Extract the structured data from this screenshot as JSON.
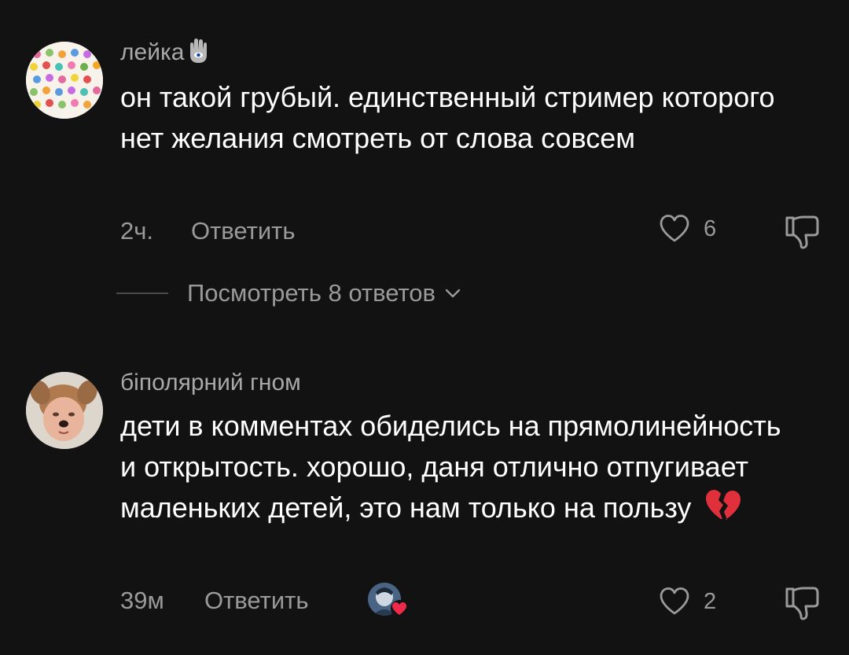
{
  "comments": [
    {
      "username": "лейка",
      "username_emoji": "hamsa",
      "text": "он такой грубый. единственный стример которого нет желания смотреть от слова совсем",
      "time": "2ч.",
      "reply_label": "Ответить",
      "likes": "6"
    },
    {
      "username": "біполярний гном",
      "text": "дети в комментах обиделись на прямолинейность и открытость. хорошо, даня отлично отпугивает маленьких детей, это нам только на пользу",
      "text_emoji": "💔",
      "time": "39м",
      "reply_label": "Ответить",
      "likes": "2"
    }
  ],
  "view_replies": {
    "label": "Посмотреть 8 ответов"
  },
  "colors": {
    "background": "#121212",
    "text_primary": "#ffffff",
    "text_secondary": "#9a9a9a",
    "broken_heart": "#e0303c"
  }
}
